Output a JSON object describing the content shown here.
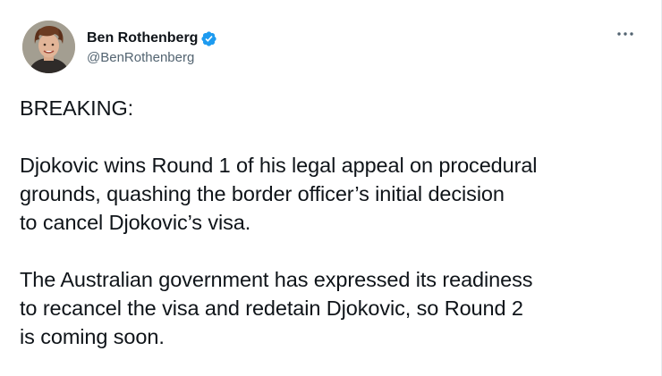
{
  "tweet": {
    "author": {
      "display_name": "Ben Rothenberg",
      "handle": "@BenRothenberg",
      "verified": true,
      "avatar_icon": "avatar-photo",
      "verified_color": "#1d9bf0"
    },
    "more_icon": "more-horizontal-icon",
    "paragraphs": [
      {
        "lines": [
          "BREAKING:"
        ]
      },
      {
        "lines": [
          "Djokovic wins Round 1 of his legal appeal on procedural",
          "grounds, quashing the border officer’s initial decision",
          "to cancel Djokovic’s visa."
        ]
      },
      {
        "lines": [
          "The Australian government has expressed its readiness",
          "to recancel the visa and redetain Djokovic, so Round 2",
          "is coming soon."
        ]
      }
    ]
  }
}
